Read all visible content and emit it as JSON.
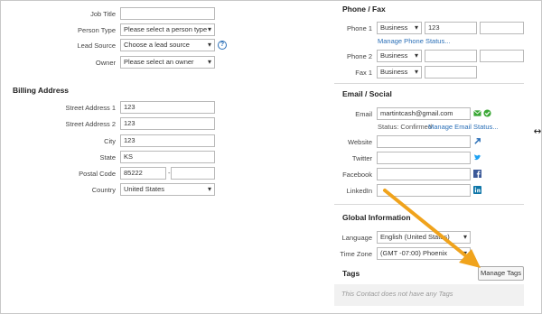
{
  "left": {
    "job_title": {
      "label": "Job Title",
      "value": ""
    },
    "person_type": {
      "label": "Person Type",
      "value": "Please select a person type"
    },
    "lead_source": {
      "label": "Lead Source",
      "value": "Choose a lead source",
      "help": "?"
    },
    "owner": {
      "label": "Owner",
      "value": "Please select an owner"
    },
    "billing_title": "Billing Address",
    "street1": {
      "label": "Street Address 1",
      "value": "123"
    },
    "street2": {
      "label": "Street Address 2",
      "value": "123"
    },
    "city": {
      "label": "City",
      "value": "123"
    },
    "state": {
      "label": "State",
      "value": "KS"
    },
    "postal": {
      "label": "Postal Code",
      "value": "85222",
      "sep": "-",
      "ext": ""
    },
    "country": {
      "label": "Country",
      "value": "United States"
    }
  },
  "right": {
    "phone_title": "Phone / Fax",
    "phone1": {
      "label": "Phone 1",
      "type": "Business",
      "value": "123",
      "ext": "",
      "manage": "Manage Phone Status..."
    },
    "phone2": {
      "label": "Phone 2",
      "type": "Business",
      "value": "",
      "ext": ""
    },
    "fax1": {
      "label": "Fax 1",
      "type": "Business",
      "value": ""
    },
    "email_title": "Email / Social",
    "email": {
      "label": "Email",
      "value": "martintcash@gmail.com",
      "status_label": "Status: Confirmed",
      "manage": "Manage Email Status..."
    },
    "website": {
      "label": "Website",
      "value": ""
    },
    "twitter": {
      "label": "Twitter",
      "value": ""
    },
    "facebook": {
      "label": "Facebook",
      "value": ""
    },
    "linkedin": {
      "label": "LinkedIn",
      "value": ""
    },
    "global_title": "Global Information",
    "language": {
      "label": "Language",
      "value": "English (United States)"
    },
    "timezone": {
      "label": "Time Zone",
      "value": "(GMT -07:00) Phoenix"
    },
    "tags_title": "Tags",
    "manage_tags": "Manage Tags",
    "tags_empty": "This Contact does not have any Tags"
  },
  "colors": {
    "link": "#2a6fb7",
    "arrow": "#f0a31c",
    "email_ok": "#3aa835",
    "twitter": "#1da1f2",
    "facebook": "#3b5998",
    "linkedin": "#0e76a8"
  }
}
